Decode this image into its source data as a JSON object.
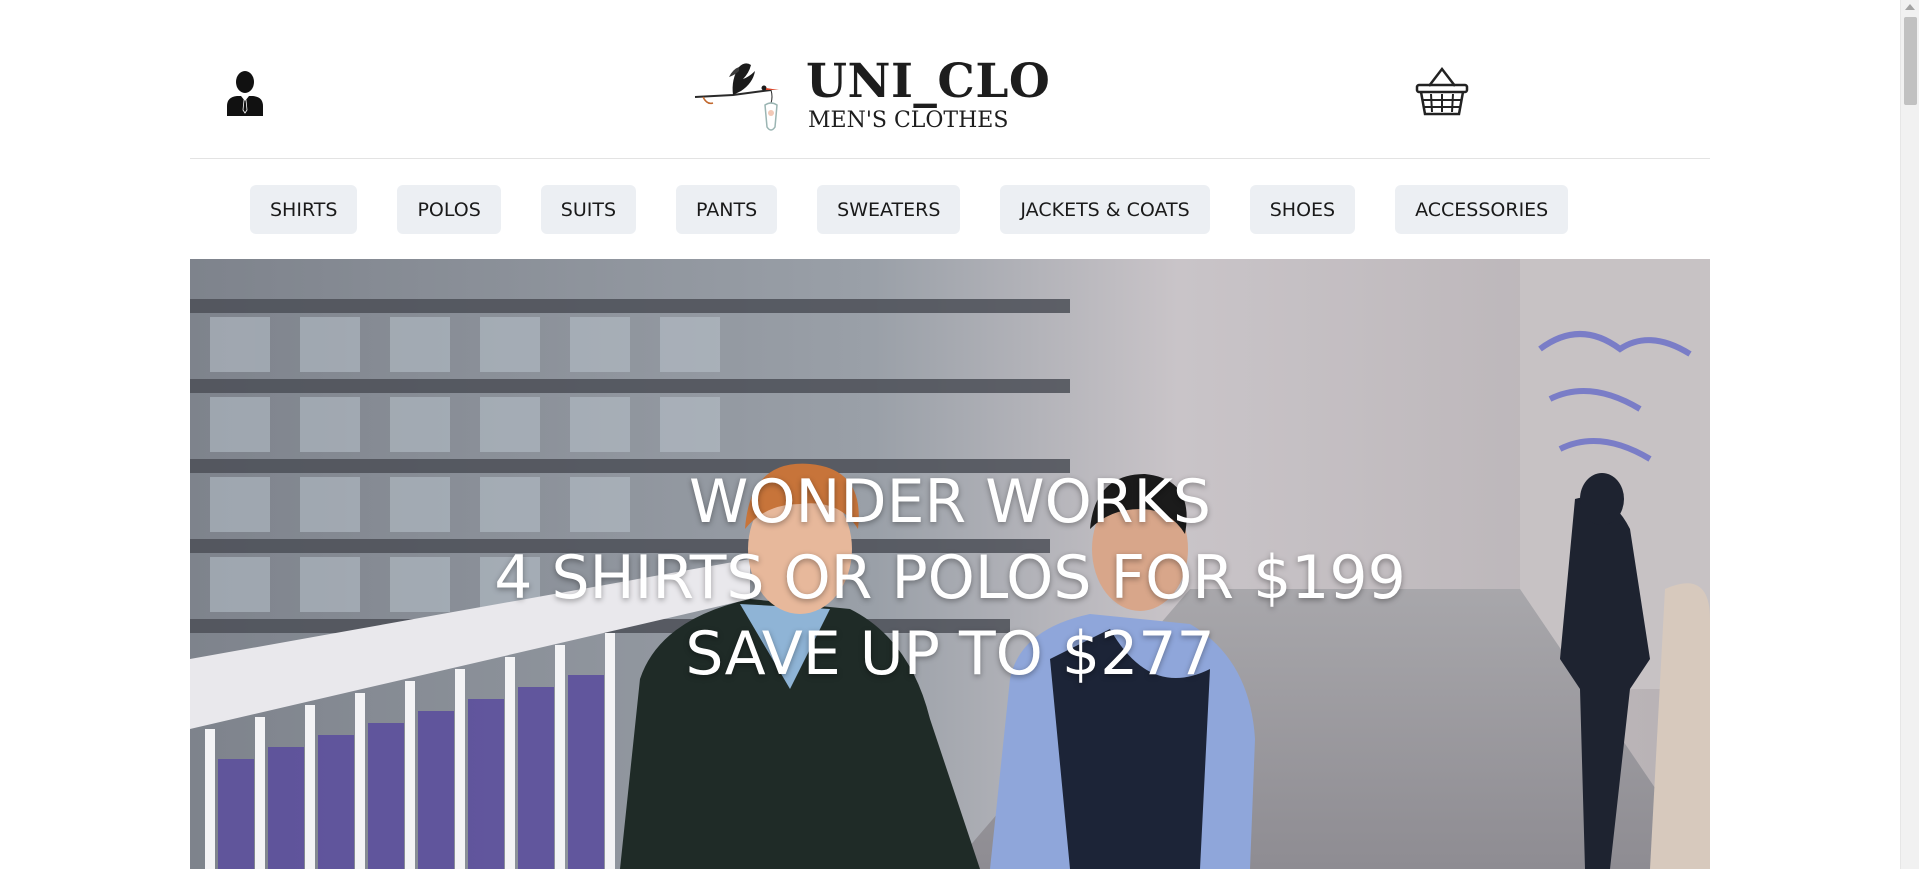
{
  "header": {
    "account_icon": "user-icon",
    "cart_icon": "basket-icon",
    "logo": {
      "name": "UNI_CLO",
      "tagline": "MEN'S CLOTHES",
      "mark_icon": "stork-icon"
    }
  },
  "nav": {
    "items": [
      {
        "label": "SHIRTS"
      },
      {
        "label": "POLOS"
      },
      {
        "label": "SUITS"
      },
      {
        "label": "PANTS"
      },
      {
        "label": "SWEATERS"
      },
      {
        "label": "JACKETS & COATS"
      },
      {
        "label": "SHOES"
      },
      {
        "label": "ACCESSORIES"
      }
    ]
  },
  "hero": {
    "lines": [
      "WONDER WORKS",
      "4 SHIRTS OR POLOS FOR $199",
      "SAVE UP TO $277"
    ]
  },
  "colors": {
    "nav_background": "#eceff3",
    "text": "#1a1a1a",
    "hero_text": "#ffffff"
  }
}
